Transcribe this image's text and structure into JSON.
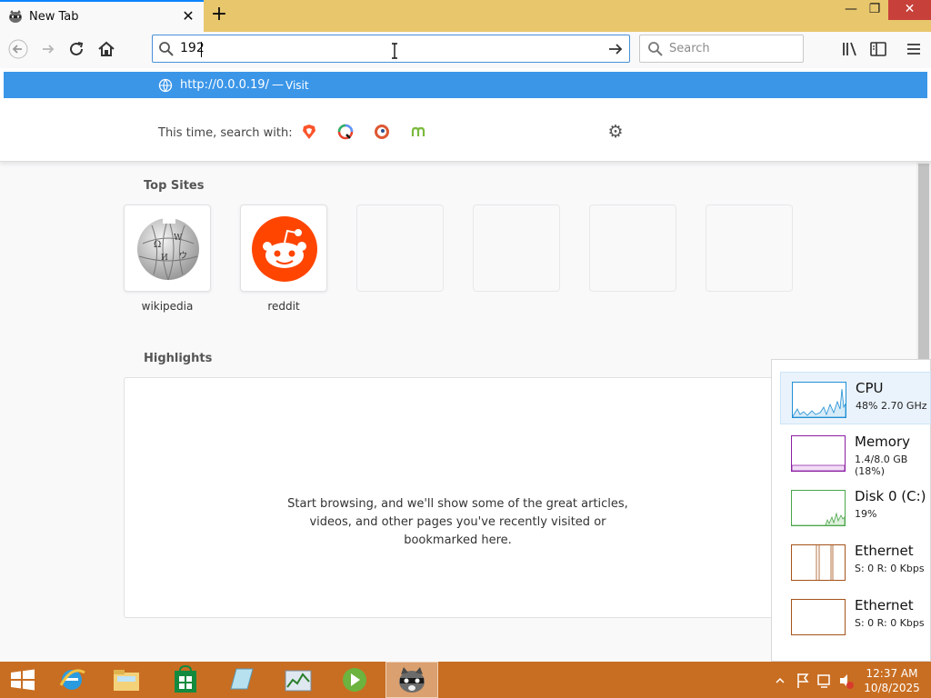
{
  "browser": {
    "tab": {
      "title": "New Tab",
      "close": "✕"
    },
    "new_tab": "+",
    "window": {
      "minimize": "—",
      "maximize": "❐",
      "close": "✕"
    },
    "nav": {
      "back": "back",
      "forward": "forward",
      "reload": "reload",
      "home": "home"
    },
    "url_bar": {
      "value": "192"
    },
    "search_bar": {
      "placeholder": "Search"
    },
    "toolbar_icons": [
      "library-icon",
      "sidebar-icon",
      "menu-icon"
    ]
  },
  "url_dropdown": {
    "suggestion": {
      "url": "http://0.0.0.19/",
      "separator": "—",
      "action": "Visit"
    },
    "one_time_label": "This time, search with:",
    "engines": [
      "brave-icon",
      "qwant-icon",
      "duckduckgo-icon",
      "mojeek-icon"
    ]
  },
  "new_tab_page": {
    "top_sites_heading": "Top Sites",
    "top_sites": [
      {
        "label": "wikipedia",
        "icon": "wikipedia-icon"
      },
      {
        "label": "reddit",
        "icon": "reddit-icon"
      },
      {
        "label": ""
      },
      {
        "label": ""
      },
      {
        "label": ""
      },
      {
        "label": ""
      }
    ],
    "highlights_heading": "Highlights",
    "highlights_message": [
      "Start browsing, and we'll show some of the great articles,",
      "videos, and other pages you've recently visited or",
      "bookmarked here."
    ]
  },
  "task_manager": {
    "items": [
      {
        "name": "CPU",
        "value": "48% 2.70 GHz",
        "color": "#1f8fd4"
      },
      {
        "name": "Memory",
        "value": "1.4/8.0 GB (18%)",
        "color": "#8b1fa3"
      },
      {
        "name": "Disk 0 (C:)",
        "value": "19%",
        "color": "#4aa64a"
      },
      {
        "name": "Ethernet",
        "value": "S: 0 R: 0 Kbps",
        "color": "#a5531a"
      },
      {
        "name": "Ethernet",
        "value": "S: 0 R: 0 Kbps",
        "color": "#a5531a"
      }
    ]
  },
  "taskbar": {
    "apps": [
      "internet-explorer-icon",
      "file-explorer-icon",
      "store-icon",
      "notepad-icon",
      "task-manager-icon",
      "media-player-icon",
      "raccoon-app-icon"
    ],
    "clock": {
      "time": "12:37 AM",
      "date": "10/8/2025"
    }
  },
  "colors": {
    "titlebar": "#e8c66c",
    "suggestion_highlight": "#3b96e8",
    "taskbar": "#c86e22",
    "close_button": "#c7403a"
  }
}
